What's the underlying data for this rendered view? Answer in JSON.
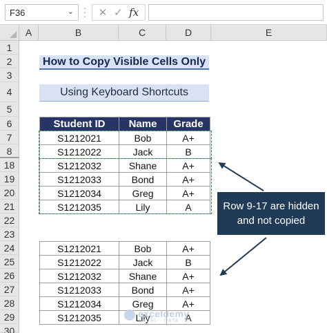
{
  "name_box": "F36",
  "name_box_dropdown_icon": "chevron-down-icon",
  "formula_buttons": {
    "cancel": "✕",
    "enter": "✓",
    "function": "fx"
  },
  "formula_value": "",
  "columns": [
    "A",
    "B",
    "C",
    "D",
    "E"
  ],
  "rows": [
    "1",
    "2",
    "3",
    "4",
    "5",
    "6",
    "7",
    "8",
    "18",
    "19",
    "20",
    "21",
    "22",
    "23",
    "24",
    "25",
    "26",
    "27",
    "28",
    "29",
    "30"
  ],
  "title": "How to Copy Visible Cells Only",
  "subtitle": "Using Keyboard Shortcuts",
  "table_headers": [
    "Student ID",
    "Name",
    "Grade"
  ],
  "source_table": [
    [
      "S1212021",
      "Bob",
      "A+"
    ],
    [
      "S1212022",
      "Jack",
      "B"
    ],
    [
      "S1212032",
      "Shane",
      "A+"
    ],
    [
      "S1212033",
      "Bond",
      "A+"
    ],
    [
      "S1212034",
      "Greg",
      "A+"
    ],
    [
      "S1212035",
      "Lily",
      "A"
    ]
  ],
  "pasted_table": [
    [
      "S1212021",
      "Bob",
      "A+"
    ],
    [
      "S1212022",
      "Jack",
      "B"
    ],
    [
      "S1212032",
      "Shane",
      "A+"
    ],
    [
      "S1212033",
      "Bond",
      "A+"
    ],
    [
      "S1212034",
      "Greg",
      "A+"
    ],
    [
      "S1212035",
      "Lily",
      "A"
    ]
  ],
  "callout": {
    "line1": "Row 9-17 are hidden",
    "line2": "and not copied"
  },
  "watermark": {
    "name": "exceldemy",
    "tagline": "EXCEL · DATA · BI"
  },
  "colors": {
    "header_fill": "#283466",
    "title_fill": "#d9e2f2",
    "callout_fill": "#1f3b57",
    "selection_dash": "#2e8b4f"
  }
}
